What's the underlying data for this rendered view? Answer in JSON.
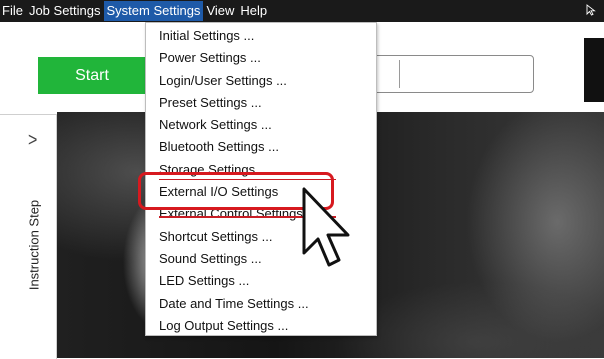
{
  "menubar": {
    "items": [
      "File",
      "Job Settings",
      "System Settings",
      "View",
      "Help"
    ],
    "active_index": 2
  },
  "toolbar": {
    "start_label": "Start"
  },
  "side_panel": {
    "chevron": ">",
    "label": "Instruction Step"
  },
  "dropdown": {
    "items": [
      "Initial Settings ...",
      "Power Settings ...",
      "Login/User Settings ...",
      "Preset Settings ...",
      "Network Settings ...",
      "Bluetooth Settings ...",
      "Storage Settings ...",
      "External I/O Settings",
      "External Control Settings ...",
      "Shortcut Settings ...",
      "Sound Settings ...",
      "LED Settings ...",
      "Date and Time Settings ...",
      "Log Output Settings ..."
    ],
    "highlighted_index": 7
  },
  "colors": {
    "menubar_bg": "#1a1a1a",
    "menu_active": "#1e5aa8",
    "start_green": "#21b53a",
    "highlight_red": "#d7191f"
  },
  "icons": {
    "cursor_small": "arrow-cursor-icon",
    "pointer_big": "hand-pointer-icon",
    "chevron": "chevron-right-icon"
  }
}
